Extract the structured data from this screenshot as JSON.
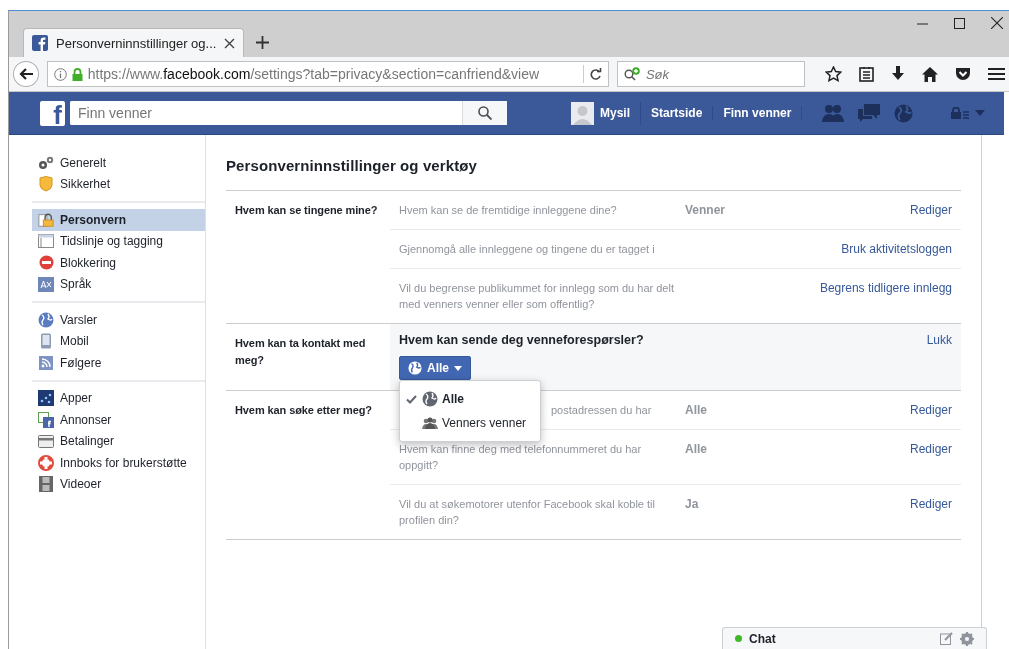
{
  "browser": {
    "tab": {
      "title": "Personverninnstillinger og...",
      "selected": true
    },
    "url": {
      "scheme": "https://www.",
      "host": "facebook.com",
      "path": "/settings?tab=privacy&section=canfriend&view"
    },
    "search": {
      "placeholder": "Søk"
    }
  },
  "topbar": {
    "logo": "f",
    "search": {
      "placeholder": "Finn venner"
    },
    "user": "Mysil",
    "links": [
      "Startside",
      "Finn venner"
    ]
  },
  "sidebar": {
    "groups": [
      [
        {
          "label": "Generelt",
          "selected": false
        },
        {
          "label": "Sikkerhet",
          "selected": false
        }
      ],
      [
        {
          "label": "Personvern",
          "selected": true
        },
        {
          "label": "Tidslinje og tagging",
          "selected": false
        },
        {
          "label": "Blokkering",
          "selected": false
        },
        {
          "label": "Språk",
          "selected": false
        }
      ],
      [
        {
          "label": "Varsler",
          "selected": false
        },
        {
          "label": "Mobil",
          "selected": false
        },
        {
          "label": "Følgere",
          "selected": false
        }
      ],
      [
        {
          "label": "Apper",
          "selected": false
        },
        {
          "label": "Annonser",
          "selected": false
        },
        {
          "label": "Betalinger",
          "selected": false
        },
        {
          "label": "Innboks for brukerstøtte",
          "selected": false
        },
        {
          "label": "Videoer",
          "selected": false
        }
      ]
    ]
  },
  "heading": "Personverninnstillinger og verktøy",
  "sections": [
    {
      "label": "Hvem kan se tingene mine?",
      "kind": "list",
      "rows": [
        {
          "question": "Hvem kan se de fremtidige innleggene dine?",
          "value": "Venner",
          "action": "Rediger"
        },
        {
          "question": "Gjennomgå alle innleggene og tingene du er tagget i",
          "action": "Bruk aktivitetsloggen"
        },
        {
          "question": "Vil du begrense publikummet for innlegg som du har delt med venners venner eller som offentlig?",
          "action": "Begrens tidligere innlegg"
        }
      ]
    },
    {
      "label": "Hvem kan ta kontakt med meg?",
      "kind": "editor",
      "question": "Hvem kan sende deg venneforespørsler?",
      "action": "Lukk",
      "selector": {
        "label": "Alle",
        "expanded": true,
        "options": [
          {
            "label": "Alle",
            "selected": true
          },
          {
            "label": "Venners venner",
            "selected": false
          }
        ]
      }
    },
    {
      "label": "Hvem kan søke etter meg?",
      "kind": "list",
      "rows": [
        {
          "question": "postadressen du har",
          "value": "Alle",
          "action": "Rediger",
          "kind": "partly-hidden"
        },
        {
          "question": "Hvem kan finne deg med telefonnummeret du har oppgitt?",
          "value": "Alle",
          "action": "Rediger"
        },
        {
          "question": "Vil du at søkemotorer utenfor Facebook skal koble til profilen din?",
          "value": "Ja",
          "action": "Rediger"
        }
      ]
    }
  ],
  "chat": {
    "label": "Chat",
    "online": true
  }
}
